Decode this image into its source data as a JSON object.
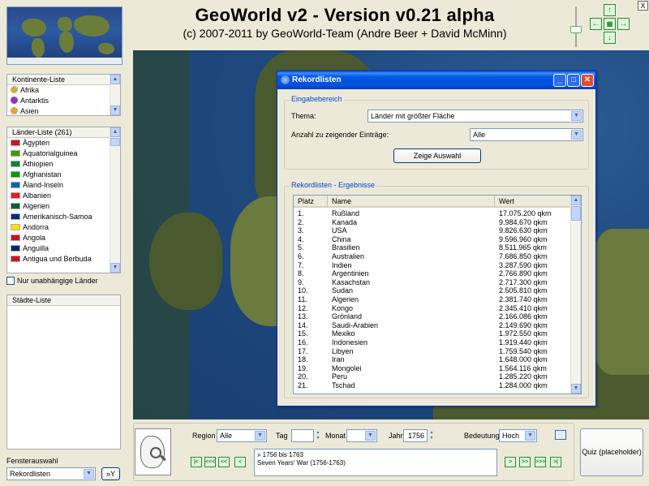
{
  "header": {
    "title": "GeoWorld v2 - Version v0.21 alpha",
    "subtitle": "(c) 2007-2011 by GeoWorld-Team (Andre Beer + David McMinn)",
    "close_label": "X"
  },
  "continents": {
    "header": "Kontinente-Liste",
    "items": [
      "Afrika",
      "Antarktis",
      "Asien"
    ]
  },
  "countries": {
    "header": "Länder-Liste  (261)",
    "items": [
      {
        "name": "Ägypten",
        "color": "#CE1126"
      },
      {
        "name": "Äquatorialguinea",
        "color": "#3E9A00"
      },
      {
        "name": "Äthiopien",
        "color": "#078930"
      },
      {
        "name": "Afghanistan",
        "color": "#009900"
      },
      {
        "name": "Åland-Inseln",
        "color": "#0064AD"
      },
      {
        "name": "Albanien",
        "color": "#E41E20"
      },
      {
        "name": "Algerien",
        "color": "#006233"
      },
      {
        "name": "Amerikanisch-Samoa",
        "color": "#002B7F"
      },
      {
        "name": "Andorra",
        "color": "#FEDF00"
      },
      {
        "name": "Angola",
        "color": "#CC092F"
      },
      {
        "name": "Anguilla",
        "color": "#00247D"
      },
      {
        "name": "Antigua und Berbuda",
        "color": "#CE1126"
      }
    ],
    "independent_label": "Nur unabhängige Länder"
  },
  "cities": {
    "header": "Städte-Liste"
  },
  "window_select": {
    "label": "Fensterauswahl",
    "value": "Rekordlisten",
    "button": "»Y"
  },
  "dialog": {
    "title": "Rekordlisten",
    "input_group": "Eingabebereich",
    "theme_label": "Thema:",
    "theme_value": "Länder mit größter Fläche",
    "count_label": "Anzahl zu zeigender Einträge:",
    "count_value": "Alle",
    "show_button": "Zeige Auswahl",
    "results_group": "Rekordlisten - Ergebnisse",
    "columns": [
      "Platz",
      "Name",
      "Wert"
    ],
    "rows": [
      [
        "1.",
        "Rußland",
        "17.075.200 qkm"
      ],
      [
        "2.",
        "Kanada",
        "9.984.670 qkm"
      ],
      [
        "3.",
        "USA",
        "9.826.630 qkm"
      ],
      [
        "4.",
        "China",
        "9.596.960 qkm"
      ],
      [
        "5.",
        "Brasilien",
        "8.511.965 qkm"
      ],
      [
        "6.",
        "Australien",
        "7.686.850 qkm"
      ],
      [
        "7.",
        "Indien",
        "3.287.590 qkm"
      ],
      [
        "8.",
        "Argentinien",
        "2.766.890 qkm"
      ],
      [
        "9.",
        "Kasachstan",
        "2.717.300 qkm"
      ],
      [
        "10.",
        "Sudan",
        "2.505.810 qkm"
      ],
      [
        "11.",
        "Algerien",
        "2.381.740 qkm"
      ],
      [
        "12.",
        "Kongo",
        "2.345.410 qkm"
      ],
      [
        "13.",
        "Grönland",
        "2.166.086 qkm"
      ],
      [
        "14.",
        "Saudi-Arabien",
        "2.149.690 qkm"
      ],
      [
        "15.",
        "Mexiko",
        "1.972.550 qkm"
      ],
      [
        "16.",
        "Indonesien",
        "1.919.440 qkm"
      ],
      [
        "17.",
        "Libyen",
        "1.759.540 qkm"
      ],
      [
        "18.",
        "Iran",
        "1.648.000 qkm"
      ],
      [
        "19.",
        "Mongolei",
        "1.564.116 qkm"
      ],
      [
        "20.",
        "Peru",
        "1.285.220 qkm"
      ],
      [
        "21.",
        "Tschad",
        "1.284.000 qkm"
      ]
    ]
  },
  "timeline": {
    "region_label": "Region",
    "region_value": "Alle",
    "day_label": "Tag",
    "day_value": "",
    "month_label": "Monat",
    "month_value": "",
    "year_label": "Jahr",
    "year_value": "1756",
    "importance_label": "Bedeutung",
    "importance_value": "Hoch",
    "event_line1": "» 1756 bis 1763",
    "event_line2": "Seven Years' War (1756-1763)",
    "nav_first": "|<",
    "nav_fast_back": "<<<",
    "nav_back2": "<<",
    "nav_back": "<",
    "nav_fwd": ">",
    "nav_fwd2": ">>",
    "nav_fast_fwd": ">>>",
    "nav_last": ">|"
  },
  "quiz": {
    "label": "Quiz (placeholder)"
  }
}
